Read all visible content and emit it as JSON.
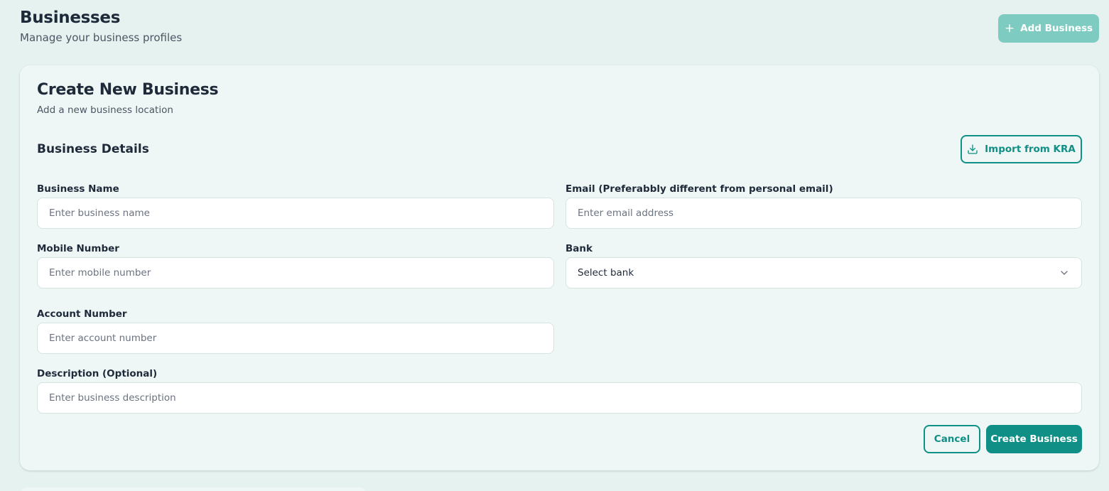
{
  "header": {
    "title": "Businesses",
    "subtitle": "Manage your business profiles",
    "add_button_label": "Add Business",
    "add_button_icon": "plus-icon"
  },
  "form": {
    "title": "Create New Business",
    "subtitle": "Add a new business location",
    "section_title": "Business Details",
    "import_button_label": "Import from KRA",
    "import_button_icon": "download-icon",
    "fields": {
      "business_name": {
        "label": "Business Name",
        "placeholder": "Enter business name",
        "value": ""
      },
      "email": {
        "label": "Email (Preferabbly different from personal email)",
        "placeholder": "Enter email address",
        "value": ""
      },
      "mobile": {
        "label": "Mobile Number",
        "placeholder": "Enter mobile number",
        "value": ""
      },
      "bank": {
        "label": "Bank",
        "selected": "Select bank",
        "icon": "chevron-down-icon"
      },
      "account_number": {
        "label": "Account Number",
        "placeholder": "Enter account number",
        "value": ""
      },
      "description": {
        "label": "Description (Optional)",
        "placeholder": "Enter business description",
        "value": ""
      }
    },
    "cancel_label": "Cancel",
    "submit_label": "Create Business"
  },
  "colors": {
    "page_bg": "#e5f2ef",
    "card_bg": "#eef7f5",
    "accent": "#0f8f85",
    "accent_light": "#7ecbc1",
    "text_dark": "#1e2a3a",
    "text_muted": "#4b5563"
  }
}
